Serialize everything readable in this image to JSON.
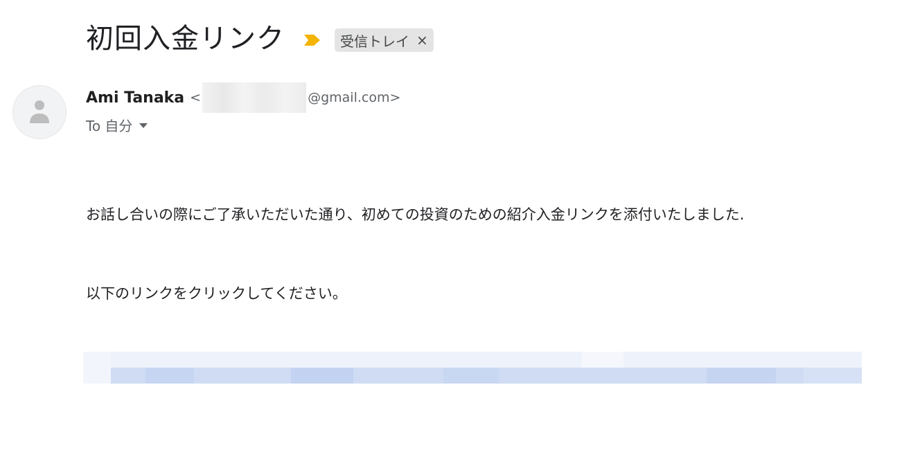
{
  "subject": "初回入金リンク",
  "label": {
    "text": "受信トレイ",
    "close": "×"
  },
  "sender": {
    "name": "Ami Tanaka",
    "email_prefix": "<",
    "email_suffix": "@gmail.com>"
  },
  "recipient": {
    "text": "To 自分"
  },
  "body": {
    "line1": "お話し合いの際にご了承いただいた通り、初めての投資のための紹介入金リンクを添付いたしました.",
    "line2": "以下のリンクをクリックしてください。"
  },
  "colors": {
    "importance": "#f4b400",
    "label_bg": "#e4e4e4",
    "link_light": "#eef3fb",
    "link_dark": "#cfdcf4"
  }
}
